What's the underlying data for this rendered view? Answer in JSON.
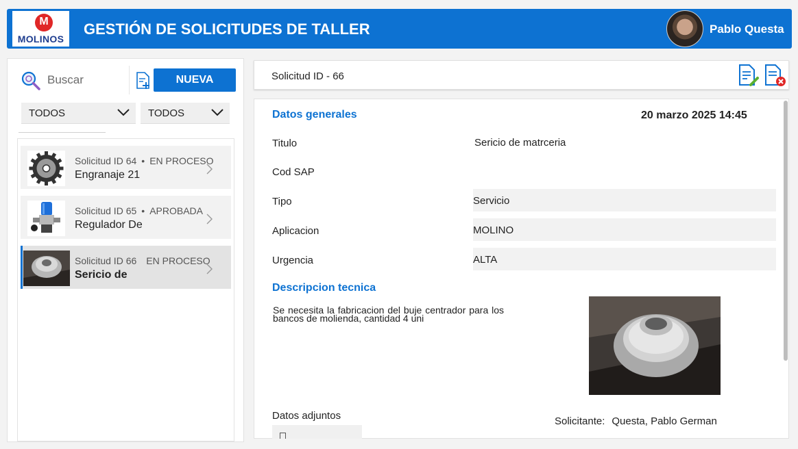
{
  "header": {
    "logo_text": "MOLINOS",
    "logo_mark": "M",
    "title": "GESTIÓN DE SOLICITUDES DE TALLER",
    "user_name": "Pablo Questa"
  },
  "sidebar": {
    "search_placeholder": "Buscar",
    "new_button": "NUEVA",
    "filter1": "TODOS",
    "filter2": "TODOS",
    "items": [
      {
        "id_label": "Solicitud ID 64",
        "sep": "•",
        "status": "EN PROCESO",
        "name": "Engranaje 21",
        "thumb": "gear-image"
      },
      {
        "id_label": "Solicitud ID 65",
        "sep": "•",
        "status": "APROBADA",
        "name": "Regulador De",
        "thumb": "regulator-image"
      },
      {
        "id_label": "Solicitud ID 66",
        "sep": "",
        "status": "EN PROCESO",
        "name": "Sericio de",
        "thumb": "bushing-image",
        "selected": true
      }
    ]
  },
  "detail_header": {
    "title": "Solicitud ID - 66",
    "edit_icon": "edit-document-icon",
    "cancel_icon": "cancel-document-icon"
  },
  "detail": {
    "general_title": "Datos generales",
    "date": "20 marzo 2025 14:45",
    "titulo_label": "Titulo",
    "titulo_value": "Sericio de matrceria",
    "codsap_label": "Cod SAP",
    "codsap_value": "",
    "tipo_label": "Tipo",
    "tipo_value": "Servicio",
    "aplicacion_label": "Aplicacion",
    "aplicacion_value": "MOLINO",
    "urgencia_label": "Urgencia",
    "urgencia_value": "ALTA",
    "desc_title": "Descripcion tecnica",
    "desc_text": "Se necesita la fabricacion del buje centrador para los bancos de molienda, cantidad 4 uni",
    "adjuntos_label": "Datos adjuntos",
    "solicitante_label": "Solicitante:",
    "solicitante_value": "Questa, Pablo German"
  },
  "colors": {
    "brand_blue": "#0d72d2",
    "logo_red": "#e02727",
    "logo_navy": "#1e3d8f"
  }
}
